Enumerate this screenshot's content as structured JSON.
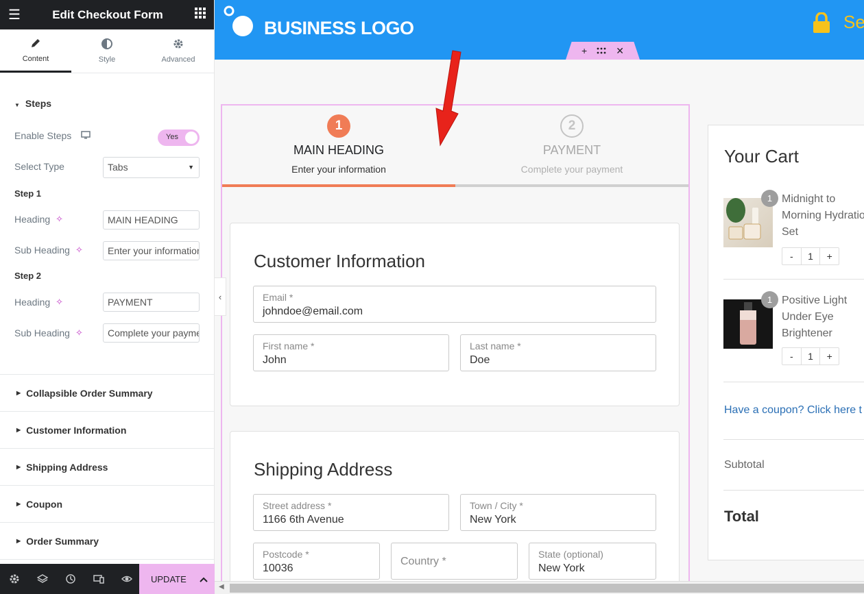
{
  "panel": {
    "title": "Edit Checkout Form",
    "tabs": [
      {
        "label": "Content",
        "icon": "pencil-icon"
      },
      {
        "label": "Style",
        "icon": "half-circle-icon"
      },
      {
        "label": "Advanced",
        "icon": "gear-icon"
      }
    ],
    "steps_section": "Steps",
    "enable_steps_label": "Enable Steps",
    "enable_steps_value": "Yes",
    "select_type_label": "Select Type",
    "select_type_value": "Tabs",
    "step1_label": "Step 1",
    "step2_label": "Step 2",
    "heading_label": "Heading",
    "subheading_label": "Sub Heading",
    "step1_heading": "MAIN HEADING",
    "step1_sub": "Enter your information",
    "step2_heading": "PAYMENT",
    "step2_sub": "Complete your payment",
    "sections": [
      "Collapsible Order Summary",
      "Customer Information",
      "Shipping Address",
      "Coupon",
      "Order Summary"
    ],
    "update_label": "UPDATE"
  },
  "header": {
    "logo": "BUSINESS LOGO",
    "secure_text": "Se"
  },
  "checkout": {
    "steps": [
      {
        "number": "1",
        "heading": "MAIN HEADING",
        "sub": "Enter your information"
      },
      {
        "number": "2",
        "heading": "PAYMENT",
        "sub": "Complete your payment"
      }
    ],
    "customer": {
      "title": "Customer Information",
      "email_label": "Email *",
      "email": "johndoe@email.com",
      "first_label": "First name *",
      "first": "John",
      "last_label": "Last name *",
      "last": "Doe"
    },
    "shipping": {
      "title": "Shipping Address",
      "street_label": "Street address *",
      "street": "1166 6th Avenue",
      "town_label": "Town / City *",
      "town": "New York",
      "postcode_label": "Postcode *",
      "postcode": "10036",
      "country_placeholder": "Country *",
      "state_label": "State (optional)",
      "state": "New York"
    }
  },
  "cart": {
    "title": "Your Cart",
    "items": [
      {
        "name": "Midnight to Morning Hydration Set",
        "badge": "1",
        "qty": "1"
      },
      {
        "name": "Positive Light Under Eye Brightener",
        "badge": "1",
        "qty": "1"
      }
    ],
    "coupon": "Have a coupon? Click here t",
    "subtotal": "Subtotal",
    "total": "Total"
  },
  "colors": {
    "accent": "#f07c56",
    "brand": "#2196f3",
    "editor_pink": "#eeb6ef",
    "link": "#2a6fb5"
  }
}
